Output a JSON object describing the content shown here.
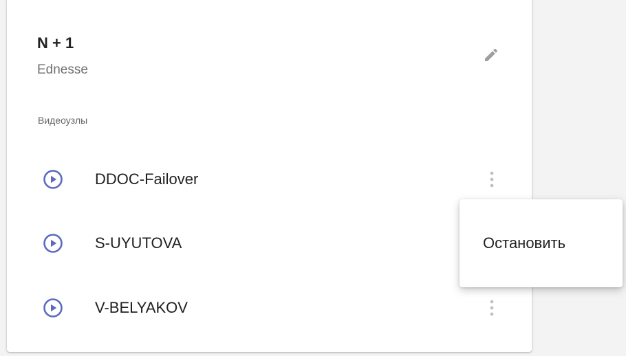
{
  "card": {
    "title": "N + 1",
    "subtitle": "Ednesse",
    "edit_icon": "pencil-icon",
    "section_label": "Видеоузлы"
  },
  "nodes": [
    {
      "name": "DDOC-Failover",
      "icon": "play-circle-icon",
      "menu_icon": "more-vert-icon"
    },
    {
      "name": "S-UYUTOVA",
      "icon": "play-circle-icon",
      "menu_icon": "more-vert-icon"
    },
    {
      "name": "V-BELYAKOV",
      "icon": "play-circle-icon",
      "menu_icon": "more-vert-icon"
    }
  ],
  "context_menu": {
    "items": [
      {
        "label": "Остановить"
      }
    ]
  },
  "colors": {
    "play_accent": "#5c6bc0",
    "icon_gray": "#9e9e9e",
    "text_primary": "#212121",
    "text_secondary": "#707070"
  }
}
